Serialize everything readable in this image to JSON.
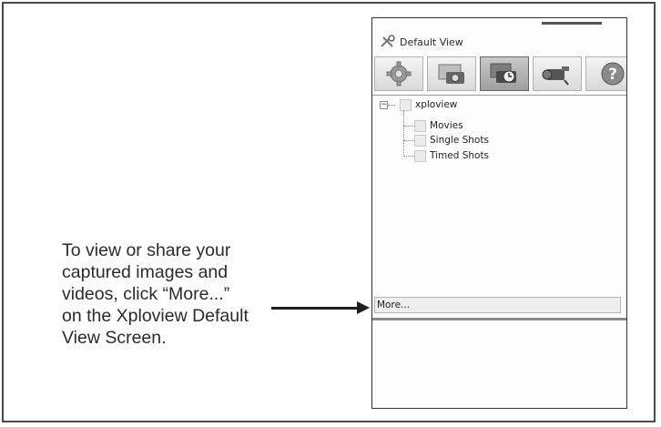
{
  "instructions": {
    "line1": "To view or share your",
    "line2": "captured images and",
    "line3": "videos, click “More...”",
    "line4": "on the Xploview Default",
    "line5": "View Screen."
  },
  "window": {
    "title": "Default View",
    "toolbar": [
      {
        "icon": "settings-gear-icon"
      },
      {
        "icon": "camera-photo-icon"
      },
      {
        "icon": "timed-shots-clock-icon",
        "active": true
      },
      {
        "icon": "video-camera-icon"
      },
      {
        "icon": "help-icon"
      }
    ],
    "tree": {
      "root": "xploview",
      "children": [
        "Movies",
        "Single Shots",
        "Timed Shots"
      ]
    },
    "more_label": "More..."
  }
}
